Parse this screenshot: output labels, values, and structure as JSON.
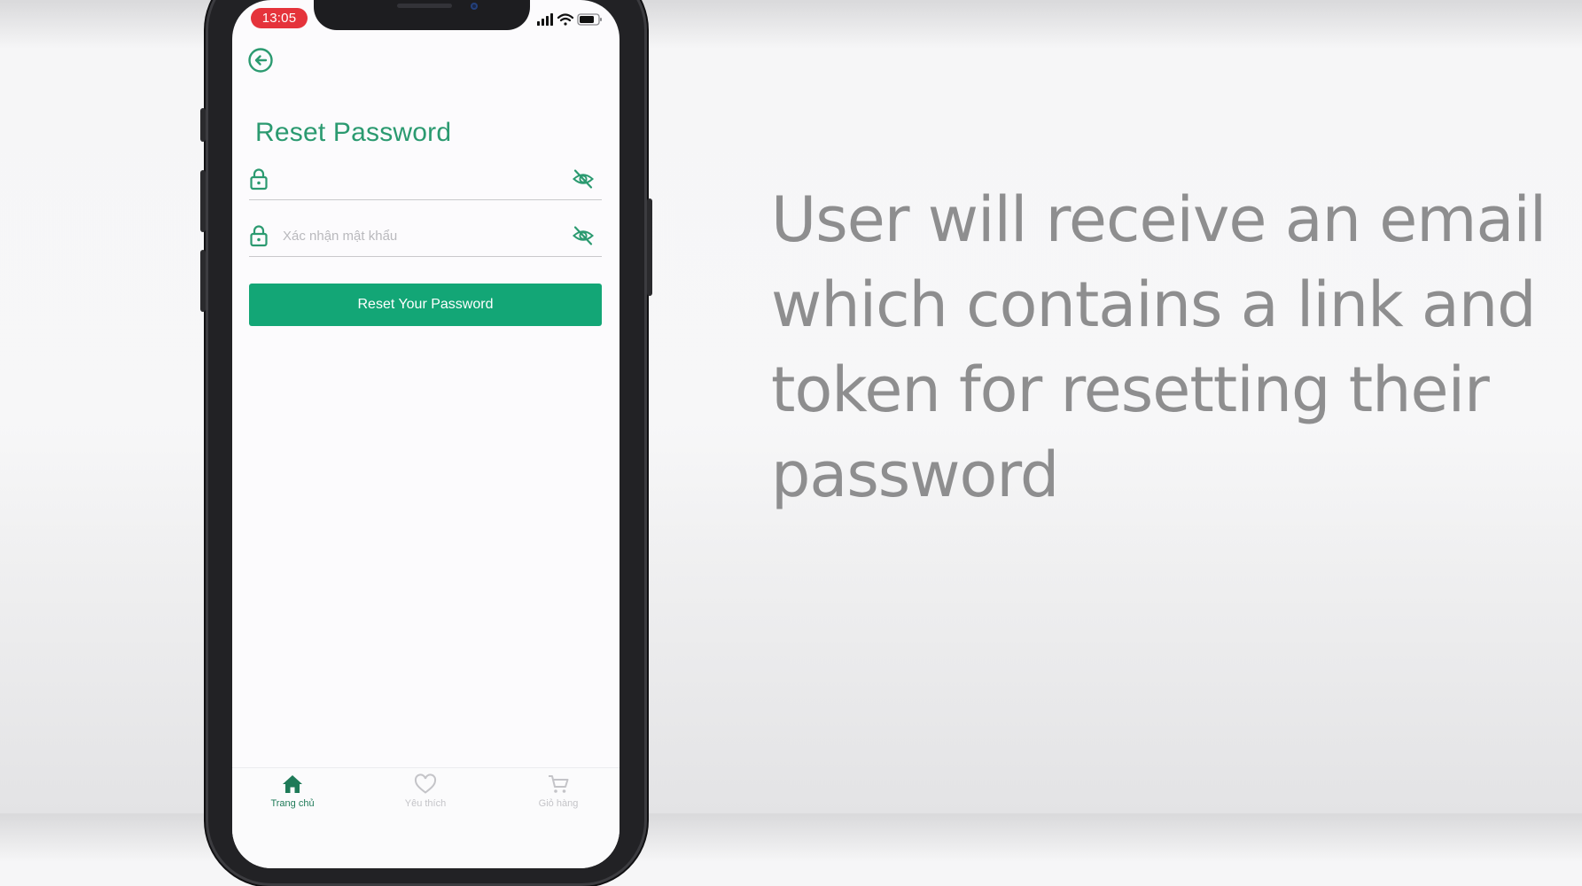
{
  "status_bar": {
    "time": "13:05",
    "icons": [
      "cellular-signal-icon",
      "wifi-icon",
      "battery-icon"
    ]
  },
  "header": {
    "back_icon": "arrow-left-circle-icon",
    "title": "Reset Password"
  },
  "form": {
    "password": {
      "value": "",
      "placeholder": "",
      "icon": "lock-icon",
      "toggle_icon": "eye-off-icon"
    },
    "confirm_password": {
      "value": "",
      "placeholder": "Xác nhận mật khẩu",
      "icon": "lock-icon",
      "toggle_icon": "eye-off-icon"
    },
    "submit_label": "Reset Your Password"
  },
  "tabbar": {
    "items": [
      {
        "label": "Trang chủ",
        "icon": "home-icon",
        "active": true
      },
      {
        "label": "Yêu thích",
        "icon": "heart-icon",
        "active": false
      },
      {
        "label": "Giỏ hàng",
        "icon": "cart-icon",
        "active": false
      }
    ]
  },
  "caption": {
    "text": "User will receive an email which contains a link and token for resetting their password"
  },
  "colors": {
    "accent": "#2b9a70",
    "button": "#13a676",
    "status_time_bg": "#e5333b",
    "caption": "#8e8e8f",
    "tab_inactive": "#c4c4c8"
  }
}
